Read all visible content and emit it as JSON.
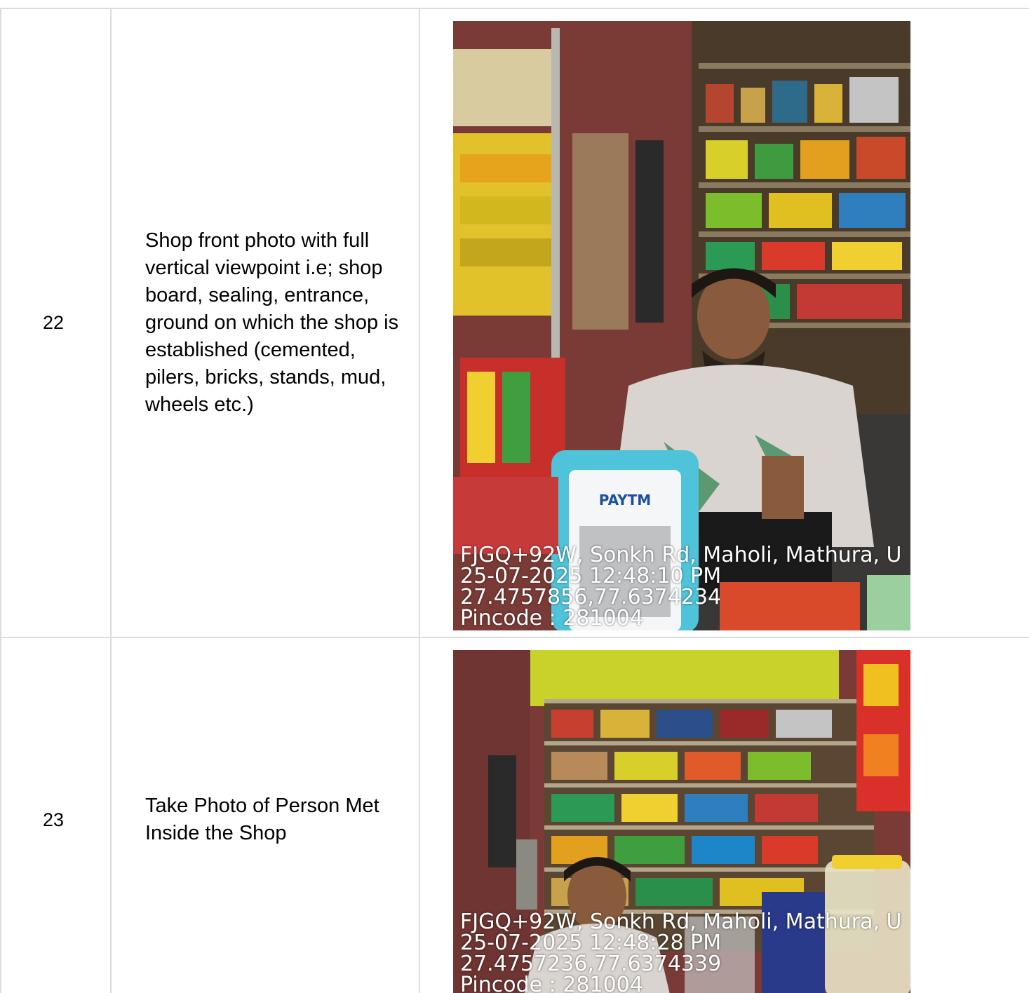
{
  "rows": [
    {
      "number": "22",
      "description": "Shop front photo with full vertical viewpoint i.e; shop board, sealing, entrance, ground on which the shop is established (cemented, pilers, bricks, stands, mud, wheels etc.)",
      "photo": {
        "alt": "Shop front photo",
        "brand_text": "PAYTM",
        "overlay": {
          "address": "FJGQ+92W, Sonkh Rd, Maholi, Mathura, U",
          "timestamp": "25-07-2025 12:48:10 PM",
          "coordinates": "27.4757856,77.6374234",
          "pincode": "Pincode : 281004"
        }
      }
    },
    {
      "number": "23",
      "description": "Take Photo of Person Met Inside the Shop",
      "photo": {
        "alt": "Person inside shop photo",
        "overlay": {
          "address": "FJGQ+92W, Sonkh Rd, Maholi, Mathura, U",
          "timestamp": "25-07-2025 12:48:28 PM",
          "coordinates": "27.4757236,77.6374339",
          "pincode": "Pincode : 281004"
        }
      }
    }
  ],
  "colors": {
    "border": "#dcdcdc",
    "overlay_text": "#ffffff",
    "wall_red": "#7a3b36",
    "wall_yellow": "#c9d22a",
    "paytm_blue": "#4fc3d9"
  }
}
